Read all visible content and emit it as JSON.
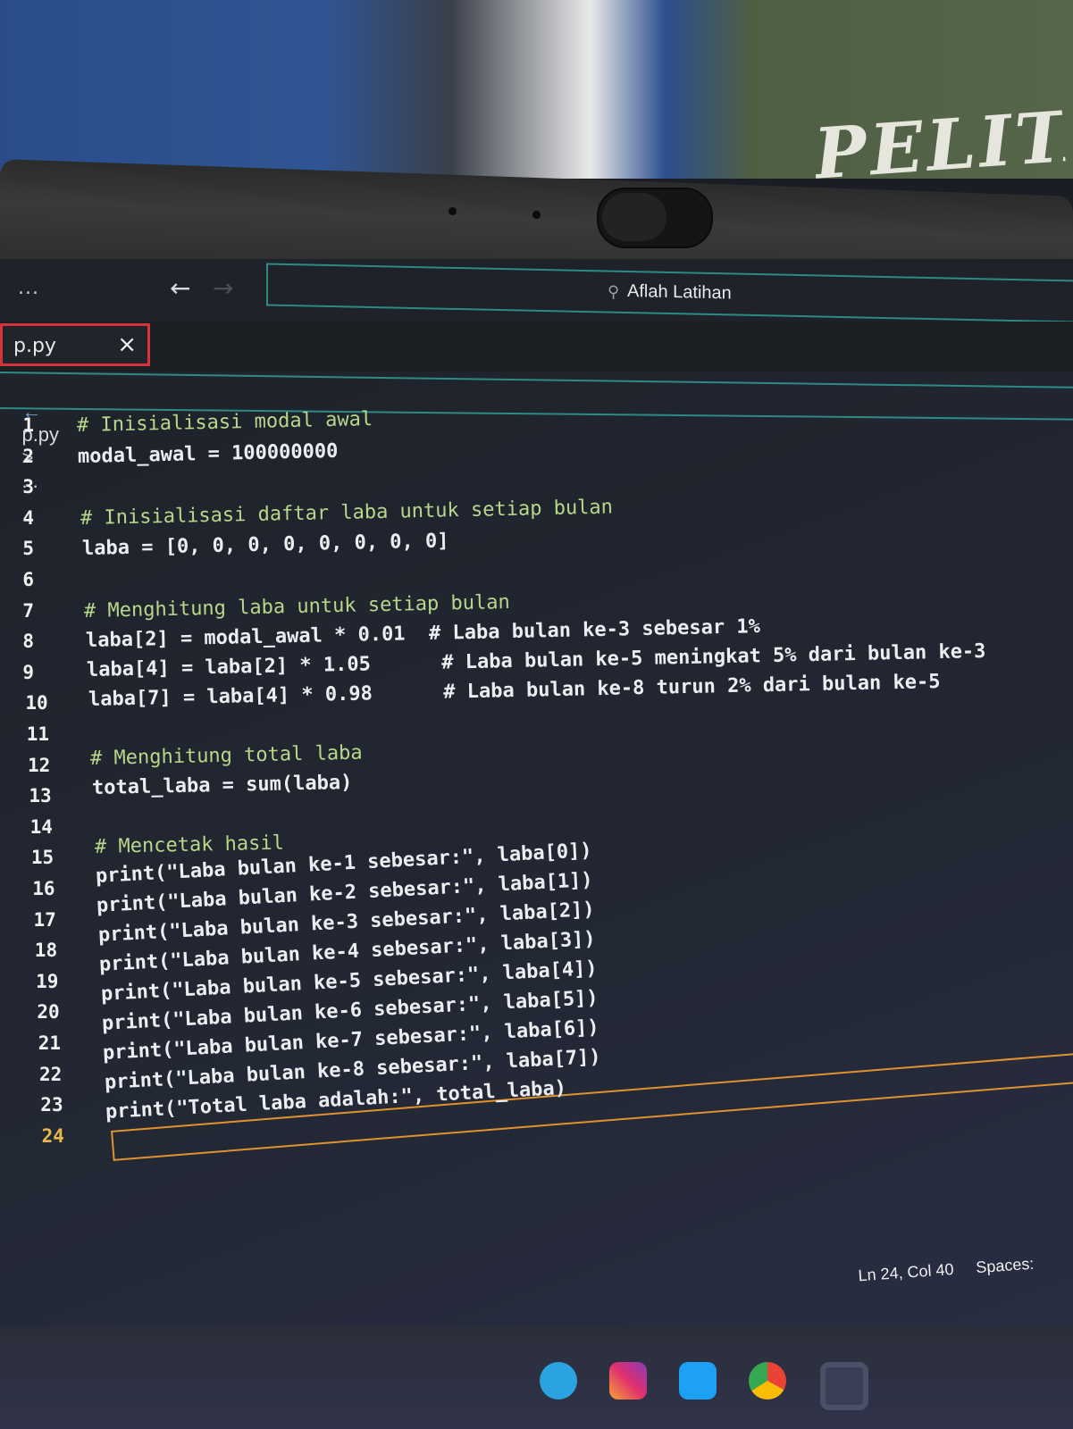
{
  "window": {
    "title": "Aflah Latihan",
    "menu_dots": "...",
    "back_icon": "arrow-left-icon",
    "forward_icon": "arrow-right-icon"
  },
  "tab": {
    "label": "p.py",
    "close_glyph": "×"
  },
  "breadcrumb": {
    "file": "p.py",
    "separator": ">",
    "more": "..."
  },
  "editor": {
    "lines": [
      {
        "n": "1",
        "text": "# Inisialisasi modal awal"
      },
      {
        "n": "2",
        "text": "modal_awal = 100000000"
      },
      {
        "n": "3",
        "text": ""
      },
      {
        "n": "4",
        "text": "# Inisialisasi daftar laba untuk setiap bulan"
      },
      {
        "n": "5",
        "text": "laba = [0, 0, 0, 0, 0, 0, 0, 0]"
      },
      {
        "n": "6",
        "text": ""
      },
      {
        "n": "7",
        "text": "# Menghitung laba untuk setiap bulan"
      },
      {
        "n": "8",
        "text": "laba[2] = modal_awal * 0.01  # Laba bulan ke-3 sebesar 1%"
      },
      {
        "n": "9",
        "text": "laba[4] = laba[2] * 1.05      # Laba bulan ke-5 meningkat 5% dari bulan ke-3"
      },
      {
        "n": "10",
        "text": "laba[7] = laba[4] * 0.98      # Laba bulan ke-8 turun 2% dari bulan ke-5"
      },
      {
        "n": "11",
        "text": ""
      },
      {
        "n": "12",
        "text": "# Menghitung total laba"
      },
      {
        "n": "13",
        "text": "total_laba = sum(laba)"
      },
      {
        "n": "14",
        "text": ""
      },
      {
        "n": "15",
        "text": "# Mencetak hasil"
      },
      {
        "n": "16",
        "text": "print(\"Laba bulan ke-1 sebesar:\", laba[0])"
      },
      {
        "n": "17",
        "text": "print(\"Laba bulan ke-2 sebesar:\", laba[1])"
      },
      {
        "n": "18",
        "text": "print(\"Laba bulan ke-3 sebesar:\", laba[2])"
      },
      {
        "n": "19",
        "text": "print(\"Laba bulan ke-4 sebesar:\", laba[3])"
      },
      {
        "n": "20",
        "text": "print(\"Laba bulan ke-5 sebesar:\", laba[4])"
      },
      {
        "n": "21",
        "text": "print(\"Laba bulan ke-6 sebesar:\", laba[5])"
      },
      {
        "n": "22",
        "text": "print(\"Laba bulan ke-7 sebesar:\", laba[6])"
      },
      {
        "n": "23",
        "text": "print(\"Laba bulan ke-8 sebesar:\", laba[7])"
      },
      {
        "n": "24",
        "text": "print(\"Total laba adalah:\", total_laba)"
      }
    ],
    "current_line": "24"
  },
  "statusbar": {
    "position": "Ln 24, Col 40",
    "indent": "Spaces:"
  },
  "background": {
    "jacket_text": "PELITA"
  },
  "taskbar": {
    "icons": [
      "telegram-icon",
      "instagram-icon",
      "twitter-icon",
      "chrome-icon",
      "vscode-icon"
    ]
  },
  "colors": {
    "accent_teal": "#2d8a86",
    "tab_border_red": "#d8323a",
    "current_line_orange": "#e0922e",
    "comment_green": "#b7d88a"
  }
}
